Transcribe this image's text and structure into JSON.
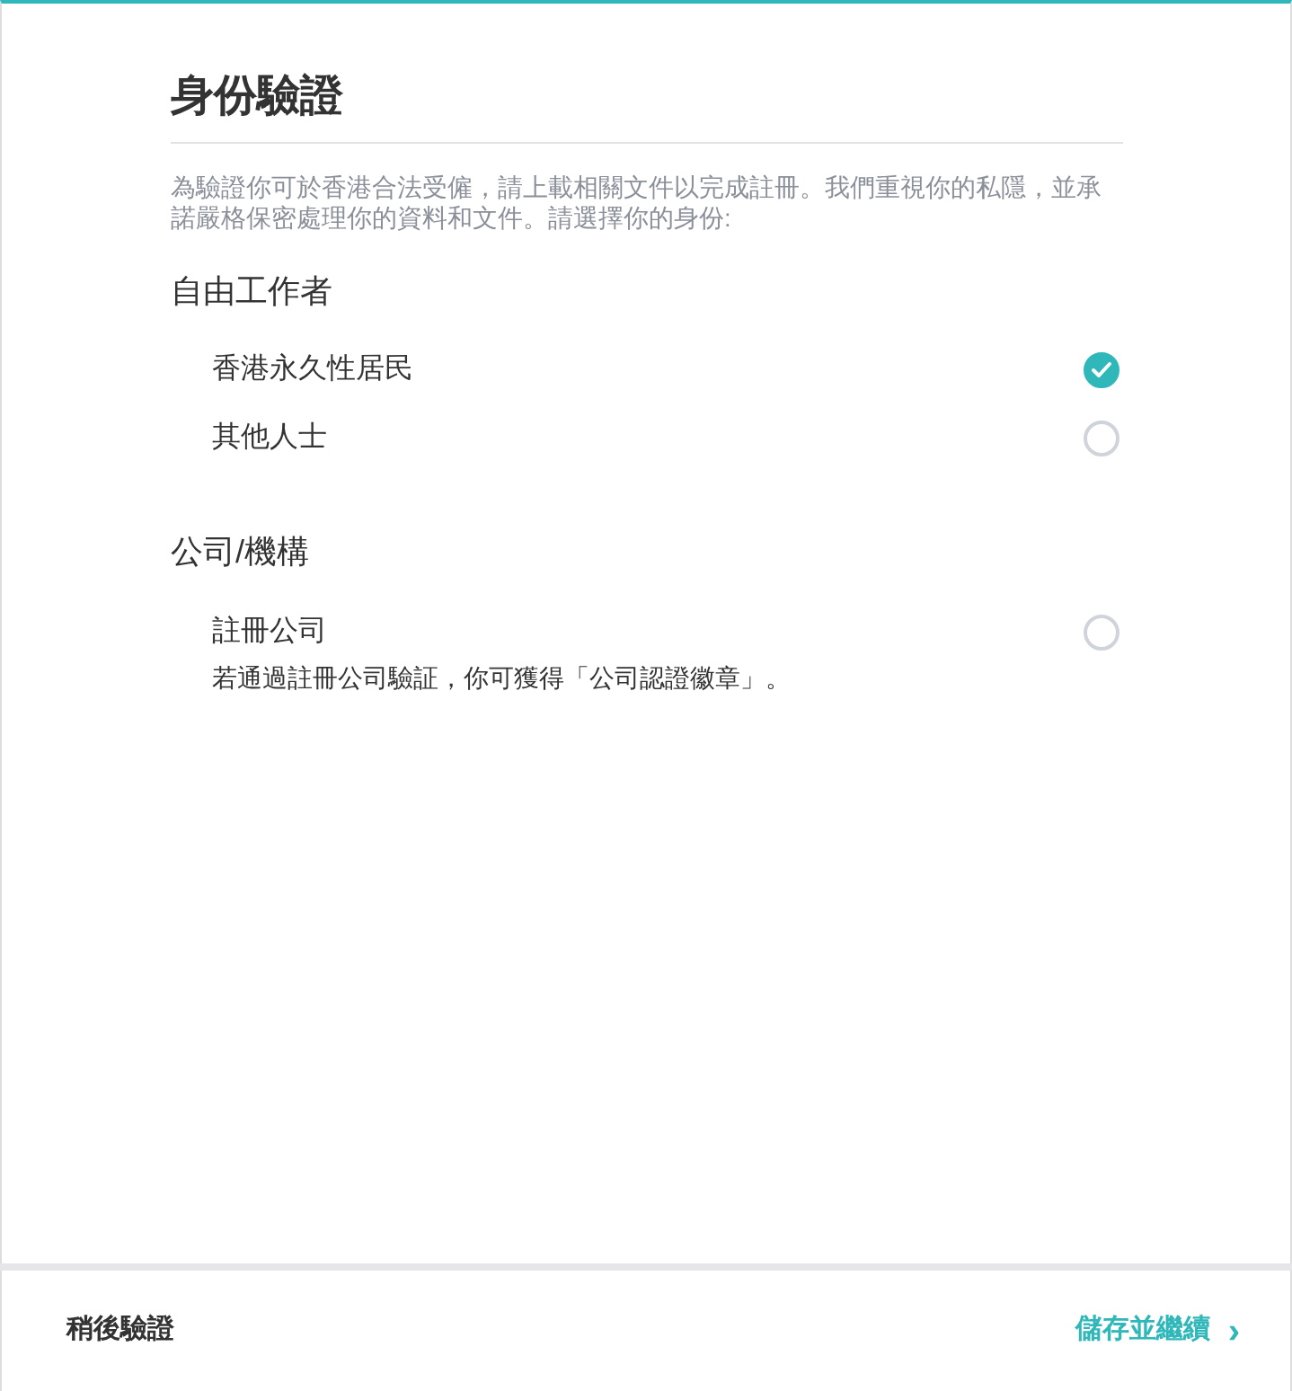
{
  "title": "身份驗證",
  "intro": "為驗證你可於香港合法受僱，請上載相關文件以完成註冊。我們重視你的私隱，並承諾嚴格保密處理你的資料和文件。請選擇你的身份:",
  "sections": [
    {
      "heading": "自由工作者",
      "options": [
        {
          "label": "香港永久性居民",
          "selected": true
        },
        {
          "label": "其他人士",
          "selected": false
        }
      ]
    },
    {
      "heading": "公司/機構",
      "options": [
        {
          "label": "註冊公司",
          "selected": false,
          "note": "若通過註冊公司驗証，你可獲得「公司認證徽章」。"
        }
      ]
    }
  ],
  "footer": {
    "later": "稍後驗證",
    "continue": "儲存並繼續",
    "continue_icon": "›"
  }
}
